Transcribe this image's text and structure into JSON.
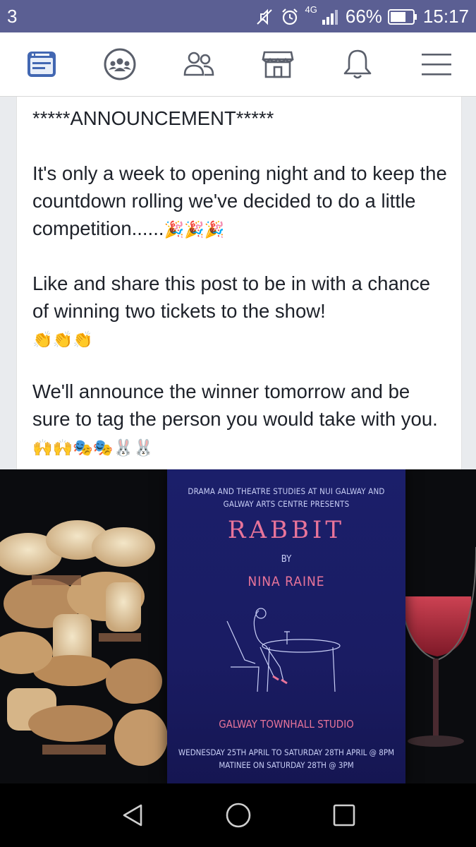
{
  "status_bar": {
    "notification_count": "3",
    "network": "4G",
    "battery": "66%",
    "time": "15:17",
    "icons": [
      "mute-icon",
      "alarm-icon",
      "signal-icon",
      "battery-icon"
    ]
  },
  "nav": {
    "items": [
      {
        "name": "news-feed-icon",
        "active": true
      },
      {
        "name": "groups-icon"
      },
      {
        "name": "friends-icon"
      },
      {
        "name": "marketplace-icon"
      },
      {
        "name": "notifications-icon"
      },
      {
        "name": "menu-icon"
      }
    ],
    "active_color": "#4267b2",
    "inactive_color": "#5a5f6b"
  },
  "post": {
    "heading": "*****ANNOUNCEMENT*****",
    "p1_text": "It's only a week to opening night and to keep the countdown rolling we've decided to do a little competition......",
    "p1_emoji": "🎉🎉🎉",
    "p2_text": "Like and share this post to be in with a chance of winning two tickets to the show!",
    "p2_emoji": "👏👏👏",
    "p3_text": "We'll announce the winner tomorrow and be sure to tag the person you would take with you.",
    "p3_emoji": "🙌🙌🎭🎭🐰🐰"
  },
  "poster": {
    "presenter": "DRAMA AND THEATRE STUDIES AT NUI GALWAY AND GALWAY ARTS CENTRE PRESENTS",
    "title": "RABBIT",
    "by": "BY",
    "author": "NINA RAINE",
    "venue": "GALWAY TOWNHALL STUDIO",
    "dates_line1": "WEDNESDAY 25TH APRIL TO SATURDAY 28TH APRIL @ 8PM",
    "dates_line2": "MATINEE ON SATURDAY 28TH @ 3PM"
  },
  "android_nav": {
    "buttons": [
      "back-icon",
      "home-icon",
      "recents-icon"
    ]
  }
}
